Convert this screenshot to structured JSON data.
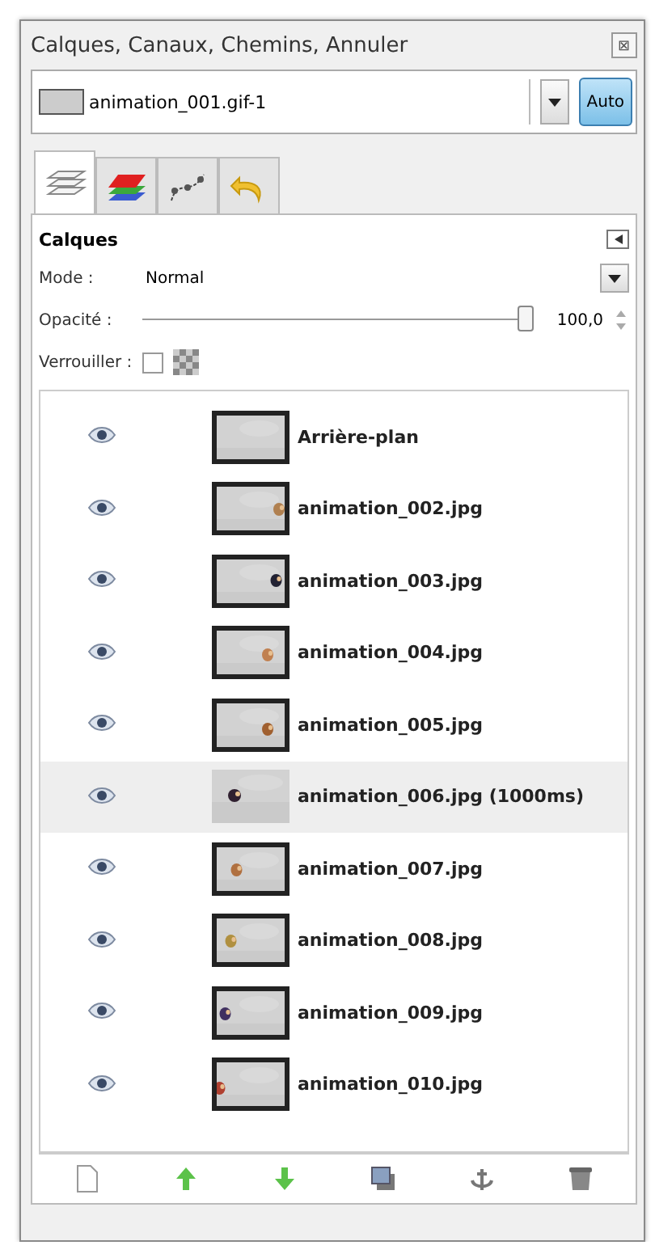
{
  "window": {
    "title": "Calques, Canaux, Chemins, Annuler",
    "close_icon_text": "⊠"
  },
  "image_selector": {
    "value": "animation_001.gif-1",
    "auto_label": "Auto",
    "auto_on": true
  },
  "tabs": [
    {
      "kind": "layers",
      "selected": true
    },
    {
      "kind": "channels",
      "selected": false
    },
    {
      "kind": "paths",
      "selected": false
    },
    {
      "kind": "undo",
      "selected": false
    }
  ],
  "panel": {
    "title": "Calques",
    "mode_label": "Mode :",
    "mode_value": "Normal",
    "opacity_label": "Opacité :",
    "opacity": {
      "level": 1.0,
      "reading": "100,0"
    },
    "lock_label": "Verrouiller :",
    "lock_pixels": {
      "checked": false
    }
  },
  "layers": [
    {
      "name": "Arrière-plan",
      "visible": true,
      "selected": false
    },
    {
      "name": "animation_002.jpg",
      "visible": true,
      "selected": false
    },
    {
      "name": "animation_003.jpg",
      "visible": true,
      "selected": false
    },
    {
      "name": "animation_004.jpg",
      "visible": true,
      "selected": false
    },
    {
      "name": "animation_005.jpg",
      "visible": true,
      "selected": false
    },
    {
      "name": "animation_006.jpg (1000ms)",
      "visible": true,
      "selected": true
    },
    {
      "name": "animation_007.jpg",
      "visible": true,
      "selected": false
    },
    {
      "name": "animation_008.jpg",
      "visible": true,
      "selected": false
    },
    {
      "name": "animation_009.jpg",
      "visible": true,
      "selected": false
    },
    {
      "name": "animation_010.jpg",
      "visible": true,
      "selected": false
    }
  ],
  "toolbar": [
    {
      "kind": "new"
    },
    {
      "kind": "raise"
    },
    {
      "kind": "lower"
    },
    {
      "kind": "duplicate"
    },
    {
      "kind": "anchor"
    },
    {
      "kind": "delete"
    }
  ]
}
